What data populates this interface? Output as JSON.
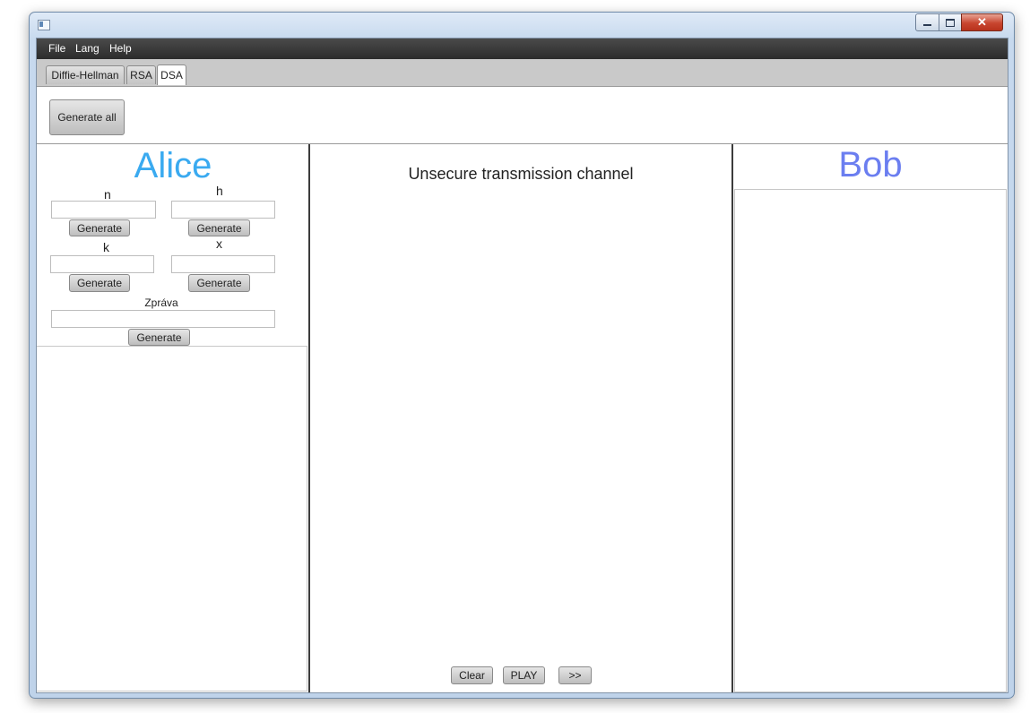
{
  "window": {
    "title": ""
  },
  "menu": {
    "items": [
      "File",
      "Lang",
      "Help"
    ]
  },
  "tabs": [
    {
      "label": "Diffie-Hellman",
      "active": false
    },
    {
      "label": "RSA",
      "active": false
    },
    {
      "label": "DSA",
      "active": true
    }
  ],
  "toolbar": {
    "generate_all": "Generate all"
  },
  "alice": {
    "title": "Alice",
    "title_color": "#3aaaf0",
    "fields": [
      {
        "label": "n",
        "value": "",
        "button": "Generate"
      },
      {
        "label": "h",
        "value": "",
        "button": "Generate"
      },
      {
        "label": "k",
        "value": "",
        "button": "Generate"
      },
      {
        "label": "x",
        "value": "",
        "button": "Generate"
      }
    ],
    "message": {
      "label": "Zpráva",
      "value": "",
      "button": "Generate"
    }
  },
  "channel": {
    "title": "Unsecure transmission channel",
    "buttons": {
      "clear": "Clear",
      "play": "PLAY",
      "next": ">>"
    }
  },
  "bob": {
    "title": "Bob",
    "title_color": "#6b7ef0"
  },
  "icons": [
    "app-icon",
    "minimize-icon",
    "maximize-icon",
    "close-icon"
  ]
}
